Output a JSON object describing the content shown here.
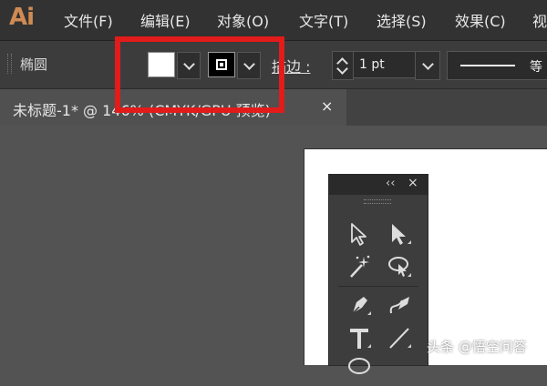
{
  "app": {
    "logo": "Ai",
    "logo_color": "#d08a54"
  },
  "menu": [
    "文件(F)",
    "编辑(E)",
    "对象(O)",
    "文字(T)",
    "选择(S)",
    "效果(C)",
    "视"
  ],
  "control_bar": {
    "tool_name": "椭圆",
    "stroke_label": "描边 :",
    "stroke_weight": "1 pt",
    "stroke_profile": "等"
  },
  "document_tab": {
    "title": "未标题-1* @ 146% (CMYK/GPU 预览)",
    "close": "×"
  },
  "tools_panel": {
    "collapse": "‹‹",
    "close": "×",
    "tools": [
      "selection-tool",
      "direct-selection-tool",
      "magic-wand-tool",
      "lasso-tool",
      "pen-tool",
      "curvature-tool",
      "type-tool",
      "line-segment-tool"
    ]
  },
  "highlight_color": "#e21b1b",
  "watermark": "头条 @悟空问答"
}
